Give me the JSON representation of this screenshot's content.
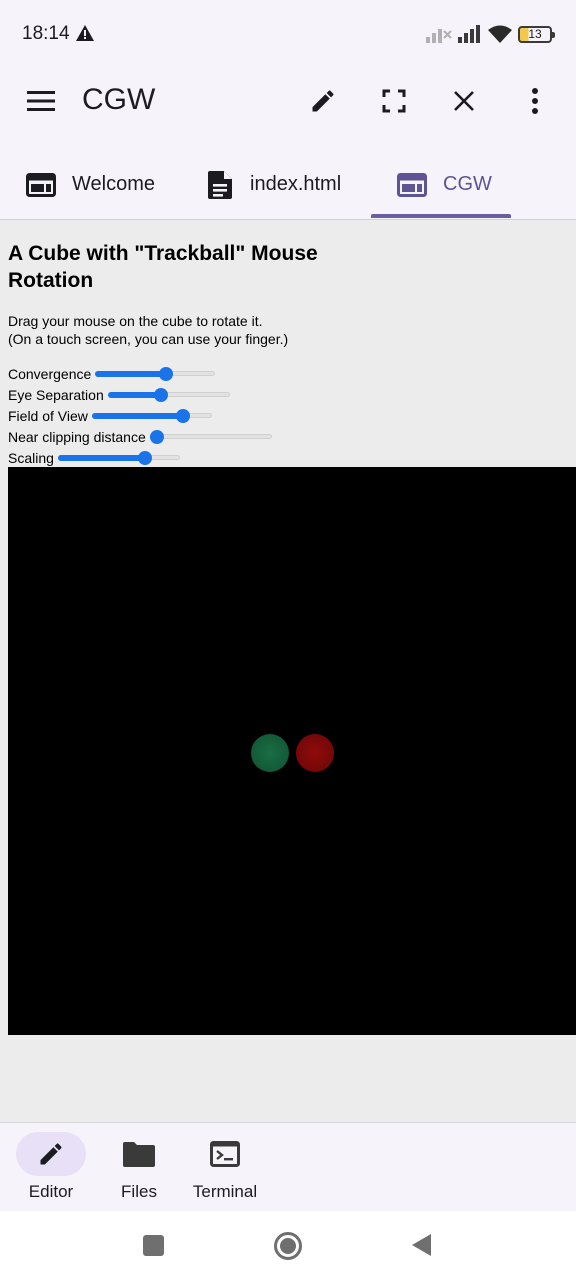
{
  "status_bar": {
    "time": "18:14",
    "battery": "13"
  },
  "app_bar": {
    "title": "CGW",
    "icons": [
      "menu-icon",
      "edit-icon",
      "fullscreen-icon",
      "close-icon",
      "more-vert-icon"
    ]
  },
  "tabs": [
    {
      "label": "Welcome",
      "icon": "web-icon",
      "active": false
    },
    {
      "label": "index.html",
      "icon": "document-icon",
      "active": false
    },
    {
      "label": "CGW",
      "icon": "web-icon",
      "active": true
    }
  ],
  "page": {
    "heading": "A Cube with \"Trackball\" Mouse Rotation",
    "description_line1": "Drag your mouse on the cube to rotate it.",
    "description_line2": "(On a touch screen, you can use your finger.)",
    "controls": [
      {
        "label": "Convergence",
        "value": 0.6
      },
      {
        "label": "Eye Separation",
        "value": 0.43
      },
      {
        "label": "Field of View",
        "value": 0.79
      },
      {
        "label": "Near clipping distance",
        "value": 0.0
      },
      {
        "label": "Scaling",
        "value": 0.74
      }
    ]
  },
  "bottom_nav": [
    {
      "label": "Editor",
      "icon": "pencil-icon",
      "active": true
    },
    {
      "label": "Files",
      "icon": "folder-icon",
      "active": false
    },
    {
      "label": "Terminal",
      "icon": "terminal-icon",
      "active": false
    }
  ],
  "colors": {
    "accent": "#6a5ea0",
    "slider": "#1a73e8",
    "canvas": "#000000"
  }
}
